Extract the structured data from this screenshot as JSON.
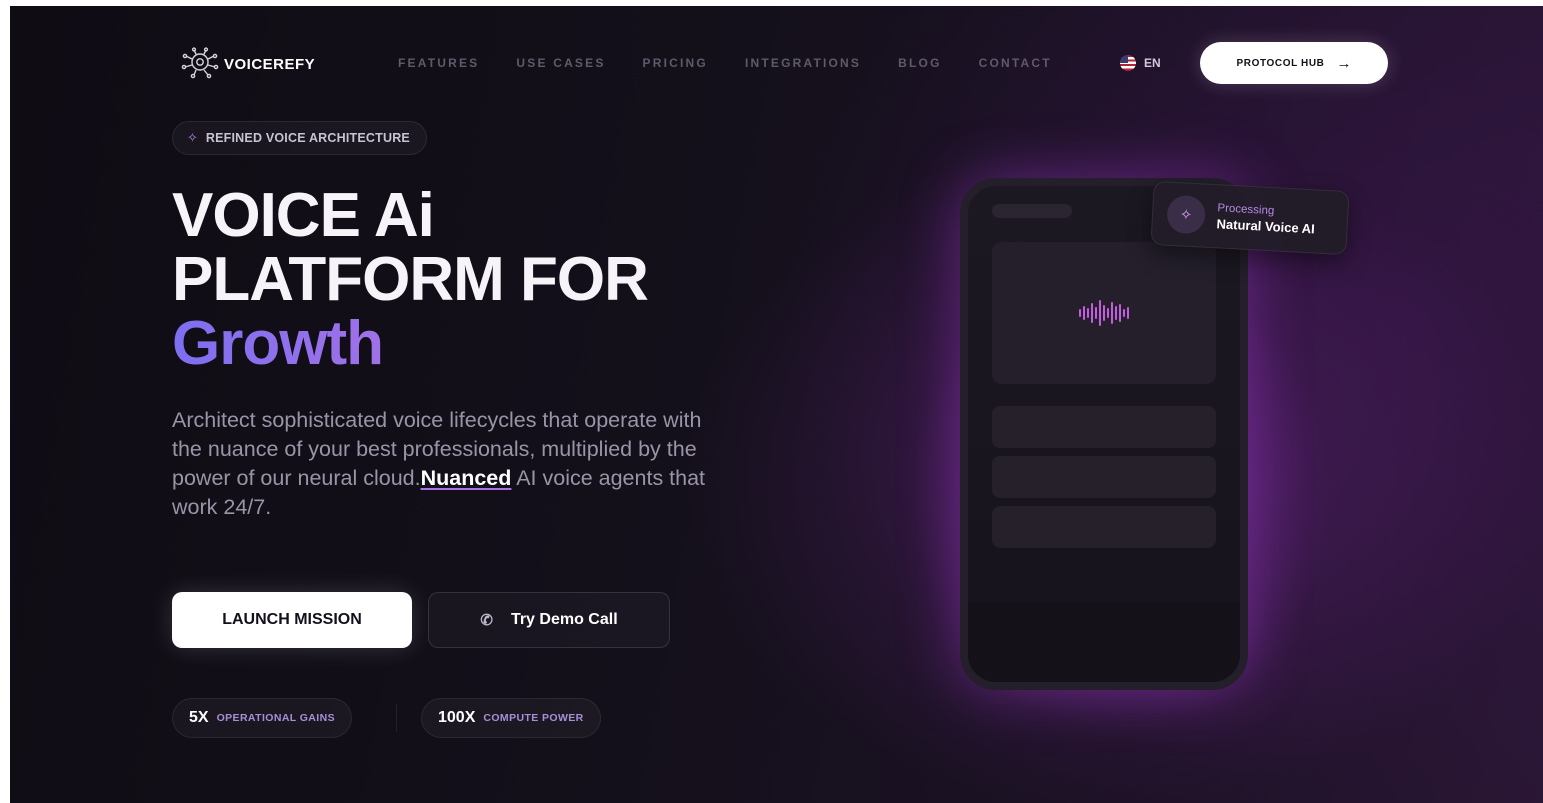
{
  "brand": {
    "name": "VOICEREFY",
    "icon": "brain-circuit-icon"
  },
  "nav": {
    "links": [
      "FEATURES",
      "USE CASES",
      "PRICING",
      "INTEGRATIONS",
      "BLOG",
      "CONTACT"
    ],
    "language": "EN",
    "cta_label": "PROTOCOL HUB",
    "cta_icon": "arrow-right-icon"
  },
  "hero": {
    "badge": "REFINED VOICE ARCHITECTURE",
    "badge_icon": "sparkle-icon",
    "headline_line1": "VOICE Ai",
    "headline_line2": "PLATFORM FOR",
    "headline_line3": "Growth",
    "description_before": "Architect sophisticated voice lifecycles that operate with the nuance of your best professionals, multiplied by the power of our neural cloud.",
    "description_highlight": "Nuanced",
    "description_after": " AI voice agents that work 24/7.",
    "primary_cta": "LAUNCH MISSION",
    "secondary_cta": "Try Demo Call",
    "secondary_cta_icon": "phone-icon"
  },
  "stats": [
    {
      "value": "5X",
      "label": "OPERATIONAL GAINS"
    },
    {
      "value": "100X",
      "label": "COMPUTE POWER"
    }
  ],
  "mockup": {
    "status_small": "Processing",
    "status_big": "Natural Voice AI",
    "status_icon": "sparkle-icon",
    "wave_icon": "sound-wave-icon"
  },
  "colors": {
    "background": "#14101b",
    "accent_purple": "#a872e6",
    "accent_glow": "#c25de0",
    "text_primary": "#ffffff",
    "text_muted": "#9a95a6"
  }
}
